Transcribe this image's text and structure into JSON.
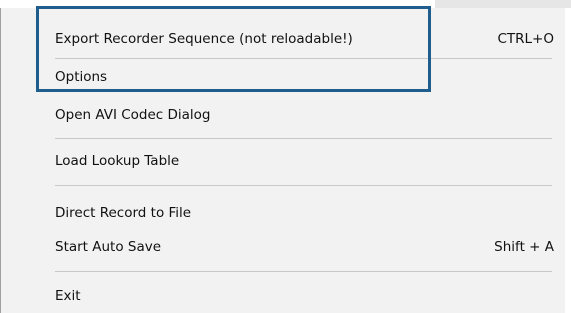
{
  "menu": {
    "items": [
      {
        "label": "Export Recorder Sequence (not reloadable!)",
        "shortcut": "CTRL+O"
      },
      {
        "label": "Options",
        "shortcut": ""
      },
      {
        "label": "Open AVI Codec Dialog",
        "shortcut": ""
      },
      {
        "label": "Load Lookup Table",
        "shortcut": ""
      },
      {
        "label": "Direct Record to File",
        "shortcut": ""
      },
      {
        "label": "Start Auto Save",
        "shortcut": "Shift + A"
      },
      {
        "label": "Exit",
        "shortcut": ""
      }
    ]
  },
  "colors": {
    "menu_background": "#f2f2f2",
    "highlight_border": "#1e5d8c",
    "separator": "#c8c8c8"
  }
}
